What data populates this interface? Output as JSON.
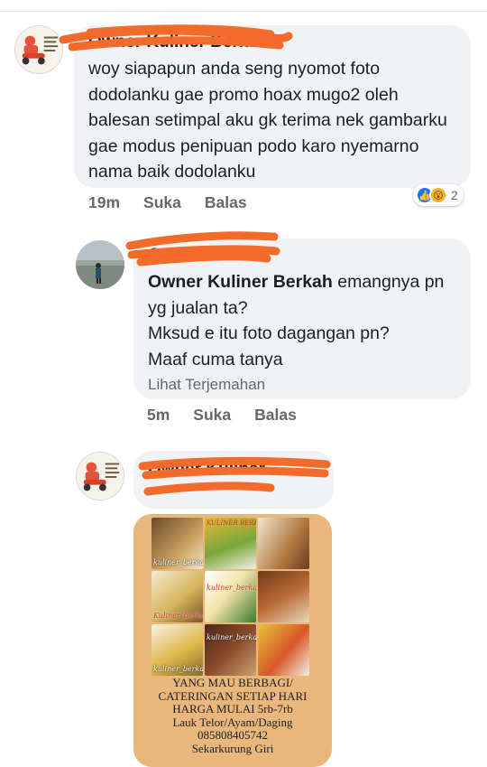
{
  "comments": [
    {
      "author_name": "Owner Kuliner Berkah",
      "text": "woy siapapun anda seng nyomot foto dodolanku gae promo hoax mugo2 oleh balesan setimpal aku gk terima nek gambarku gae modus penipuan podo karo nyemarno nama baik dodolanku",
      "time": "19m",
      "like_label": "Suka",
      "reply_label": "Balas",
      "reaction_count": "2"
    },
    {
      "author_name": "G",
      "mention": "Owner Kuliner Berkah",
      "text_after_mention": " emangnya pn yg jualan ta?",
      "line2": "Mksud e itu foto dagangan pn?",
      "line3": "Maaf cuma tanya",
      "translate_label": "Lihat Terjemahan",
      "time": "5m",
      "like_label": "Suka",
      "reply_label": "Balas"
    },
    {
      "author_name": "Owner Kuliner Berkah"
    }
  ],
  "post_image": {
    "header": "KULINER BERKAH",
    "tile_labels": [
      "kuliner_berkah",
      "kuliner_berkah",
      "Kuliner_berkah",
      "kuliner_berkah",
      "kuliner_berkah"
    ],
    "caption_lines": [
      "YANG MAU BERBAGI/",
      "CATERINGAN SETIAP HARI",
      "HARGA MULAI 5rb-7rb",
      "Lauk Telor/Ayam/Daging",
      "085808405742",
      "Sekarkurung Giri"
    ]
  },
  "colors": {
    "bubble": "#f0f2f5",
    "meta_text": "#65676b",
    "scribble": "#f36b2b",
    "image_bg": "#e9b77c"
  },
  "icons": [
    "like-reaction-icon",
    "wow-reaction-icon",
    "scooter-logo-icon"
  ]
}
